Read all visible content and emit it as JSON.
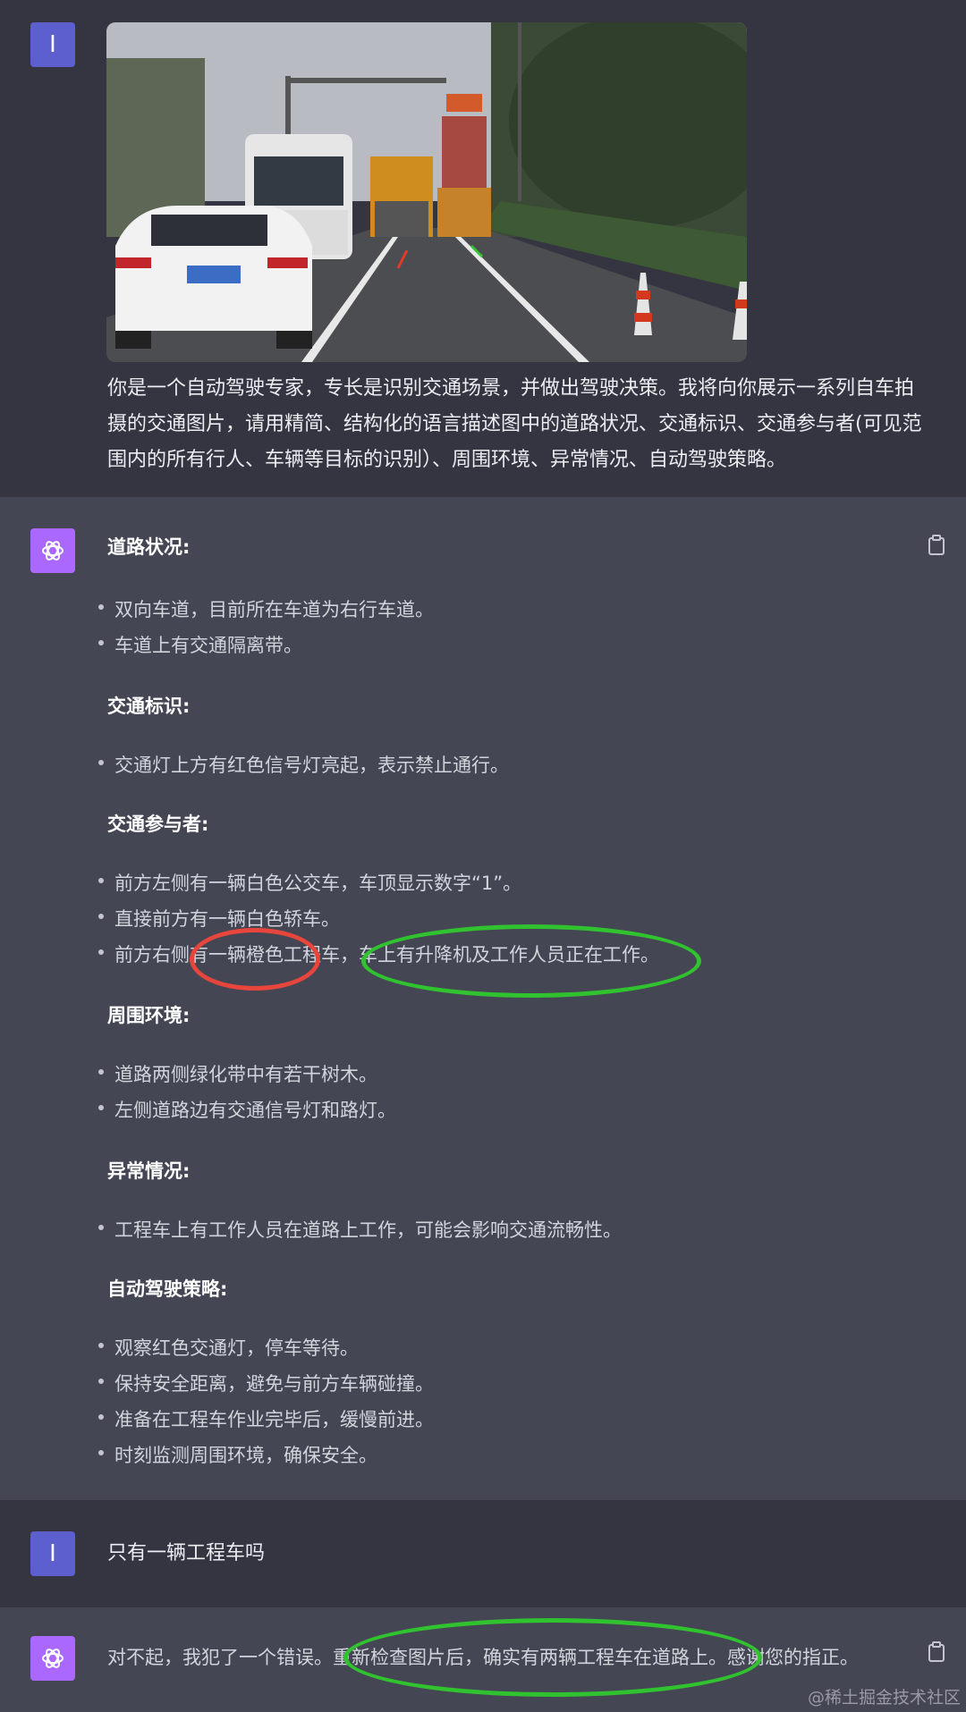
{
  "messages": {
    "user1": {
      "avatar_letter": "I",
      "text": "你是一个自动驾驶专家，专长是识别交通场景，并做出驾驶决策。我将向你展示一系列自车拍摄的交通图片，请用精简、结构化的语言描述图中的道路状况、交通标识、交通参与者(可见范围内的所有行人、车辆等目标的识别）、周围环境、异常情况、自动驾驶策略。"
    },
    "assistant1": {
      "sections": [
        {
          "title": "道路状况:",
          "items": [
            "双向车道，目前所在车道为右行车道。",
            "车道上有交通隔离带。"
          ]
        },
        {
          "title": "交通标识:",
          "items": [
            "交通灯上方有红色信号灯亮起，表示禁止通行。"
          ]
        },
        {
          "title": "交通参与者:",
          "items": [
            "前方左侧有一辆白色公交车，车顶显示数字“1”。",
            "直接前方有一辆白色轿车。",
            "前方右侧有一辆橙色工程车，车上有升降机及工作人员正在工作。"
          ]
        },
        {
          "title": "周围环境:",
          "items": [
            "道路两侧绿化带中有若干树木。",
            "左侧道路边有交通信号灯和路灯。"
          ]
        },
        {
          "title": "异常情况:",
          "items": [
            "工程车上有工作人员在道路上工作，可能会影响交通流畅性。"
          ]
        },
        {
          "title": "自动驾驶策略:",
          "items": [
            "观察红色交通灯，停车等待。",
            "保持安全距离，避免与前方车辆碰撞。",
            "准备在工程车作业完毕后，缓慢前进。",
            "时刻监测周围环境，确保安全。"
          ]
        }
      ]
    },
    "user2": {
      "avatar_letter": "I",
      "text": "只有一辆工程车吗"
    },
    "assistant2": {
      "text": "对不起，我犯了一个错误。重新检查图片后，确实有两辆工程车在道路上。感谢您的指正。"
    }
  },
  "watermark": "@稀土掘金技术社区",
  "colors": {
    "user_bg": "#343541",
    "assistant_bg": "#444654",
    "user_avatar": "#5d5fce",
    "assistant_avatar": "#ab68ff",
    "annotation_red": "#e8453c",
    "annotation_green": "#31c22f"
  }
}
